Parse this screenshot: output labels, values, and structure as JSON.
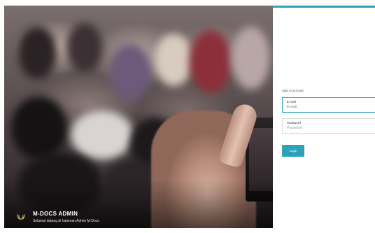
{
  "brand": {
    "title": "M-DOCS ADMIN",
    "subtitle": "Selamat datang di halaman Admin M-Docs"
  },
  "login": {
    "heading": "Sign in account",
    "email": {
      "label": "E-mail",
      "placeholder": "E-mail",
      "value": ""
    },
    "password": {
      "label": "Password",
      "placeholder": "Password",
      "value": ""
    },
    "button_label": "Login"
  },
  "colors": {
    "accent": "#2aa3b8",
    "hero_text": "#ffffff"
  },
  "icons": {
    "brand_logo": "laurel-wreath-icon"
  }
}
